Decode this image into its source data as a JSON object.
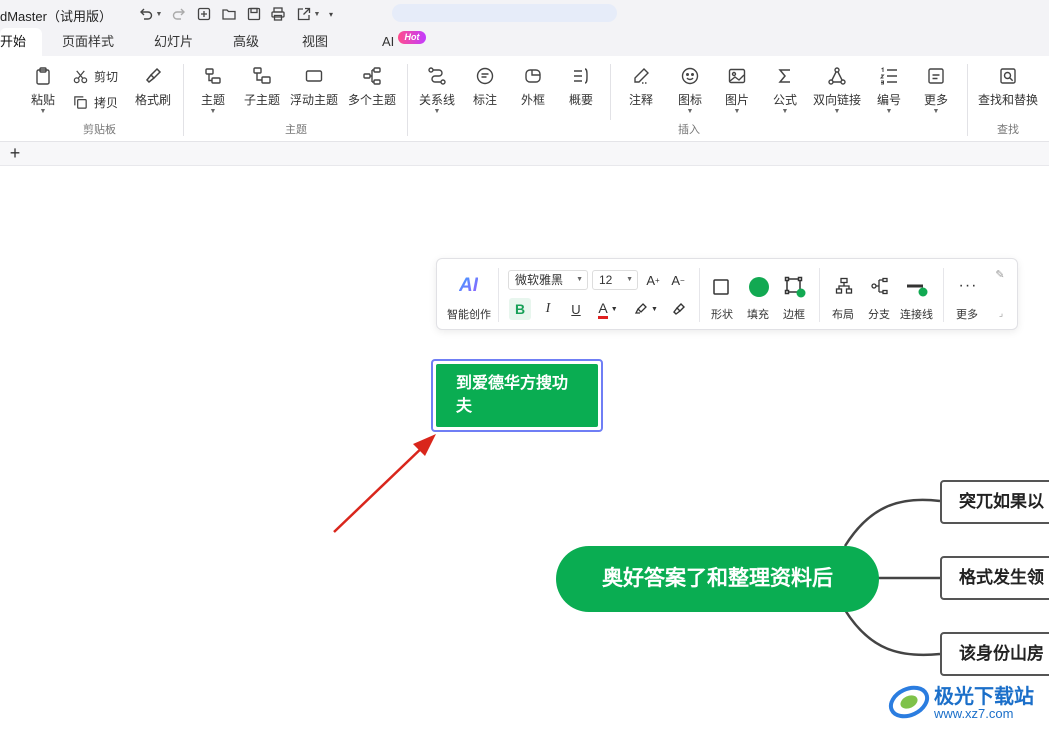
{
  "titlebar": {
    "title": "dMaster（试用版）"
  },
  "tabs": [
    {
      "label": "开始",
      "active": true
    },
    {
      "label": "页面样式"
    },
    {
      "label": "幻灯片"
    },
    {
      "label": "高级"
    },
    {
      "label": "视图"
    },
    {
      "label": "AI"
    }
  ],
  "hot_badge": "Hot",
  "ribbon": {
    "clipboard": {
      "paste": "粘贴",
      "cut": "剪切",
      "copy": "拷贝",
      "format_painter": "格式刷",
      "group": "剪贴板"
    },
    "topic": {
      "topic": "主题",
      "subtopic": "子主题",
      "floating": "浮动主题",
      "multiple": "多个主题",
      "group": "主题"
    },
    "insert": {
      "relationship": "关系线",
      "callout": "标注",
      "boundary": "外框",
      "summary": "概要",
      "note": "注释",
      "icon": "图标",
      "image": "图片",
      "formula": "公式",
      "bidirectional": "双向链接",
      "numbering": "编号",
      "more": "更多",
      "group": "插入"
    },
    "find": {
      "find_replace": "查找和替换",
      "group": "查找"
    }
  },
  "sheetbar": {
    "add": "+"
  },
  "floating_toolbar": {
    "ai_logo": "AI",
    "ai_label": "智能创作",
    "font": "微软雅黑",
    "size": "12",
    "bold": "B",
    "italic": "I",
    "underline": "U",
    "font_color": "A",
    "shape": "形状",
    "fill": "填充",
    "border": "边框",
    "layout": "布局",
    "branch": "分支",
    "connector": "连接线",
    "more": "更多",
    "fill_color": "#12a952"
  },
  "mindmap": {
    "selected_topic": "到爱德华方搜功夫",
    "central_topic": "奥好答案了和整理资料后",
    "subtopics": [
      "突兀如果以",
      "格式发生领",
      "该身份山房"
    ],
    "topic_color": "#0aad52",
    "selection_color": "#6f7ef5",
    "arrow_color": "#d9261c"
  },
  "watermark": {
    "title": "极光下载站",
    "url": "www.xz7.com"
  }
}
